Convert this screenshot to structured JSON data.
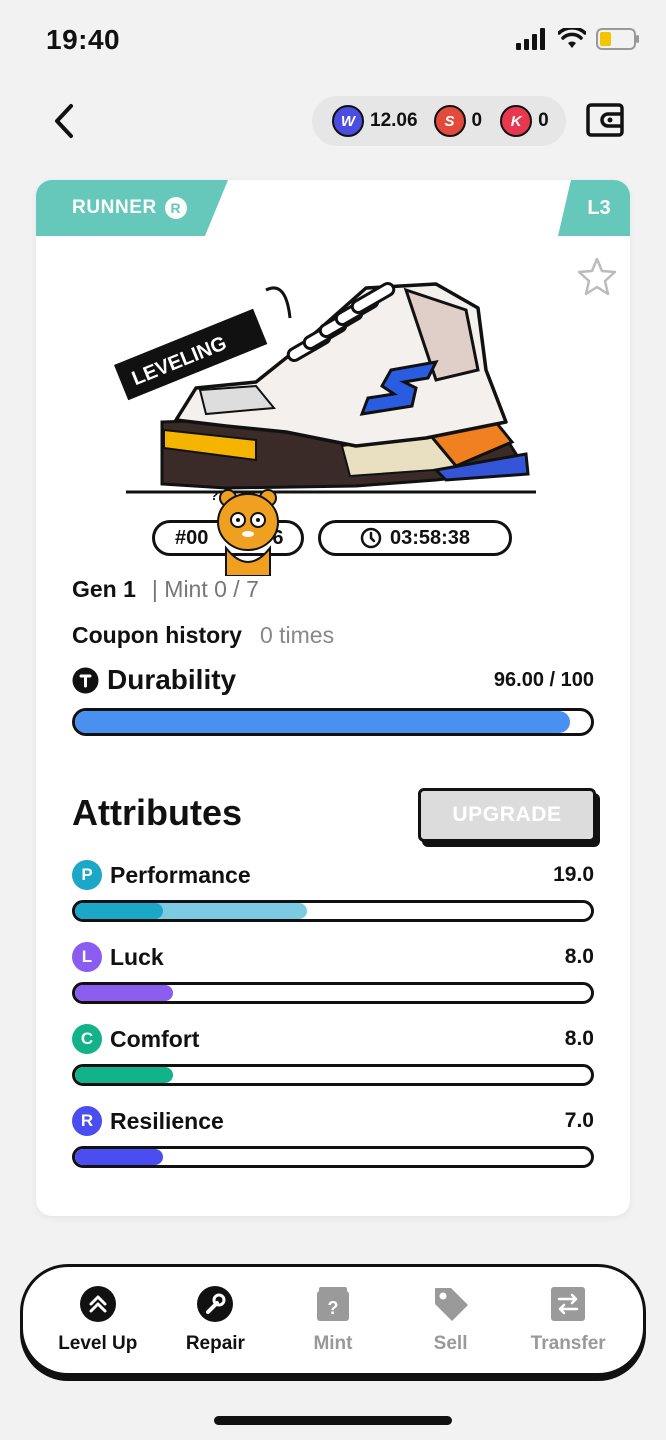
{
  "status_bar": {
    "time": "19:40",
    "battery_level": 0.35
  },
  "header": {
    "tokens": [
      {
        "name": "gmt",
        "value": "12.06",
        "icon": "w-coin-icon",
        "color": "#4a4de0",
        "glyph": "W"
      },
      {
        "name": "sgt",
        "value": "0",
        "icon": "s-coin-icon",
        "color": "#e24a3c",
        "glyph": "S"
      },
      {
        "name": "kgt",
        "value": "0",
        "icon": "k-coin-icon",
        "color": "#e8384f",
        "glyph": "K"
      }
    ]
  },
  "card": {
    "type_label": "RUNNER",
    "type_badge": "R",
    "level": "L3",
    "leveling_tag": "LEVELING",
    "shoe_id": "#00",
    "shoe_id_suffix": "6",
    "timer": "03:58:38",
    "gen": "Gen 1",
    "mint": "| Mint 0 / 7",
    "coupon_label": "Coupon history",
    "coupon_value": "0 times",
    "durability_label": "Durability",
    "durability_value": "96.00 / 100",
    "durability_fraction": 0.96,
    "accent_color": "#66c8bb"
  },
  "attributes": {
    "title": "Attributes",
    "upgrade_label": "UPGRADE",
    "items": [
      {
        "badge": "P",
        "name": "Performance",
        "value": "19.0",
        "color": "#1aa7c8",
        "base_fraction": 0.17,
        "boost_fraction": 0.45,
        "boost_color": "#7ccbe3"
      },
      {
        "badge": "L",
        "name": "Luck",
        "value": "8.0",
        "color": "#8b5cf0",
        "base_fraction": 0.19
      },
      {
        "badge": "C",
        "name": "Comfort",
        "value": "8.0",
        "color": "#12b389",
        "base_fraction": 0.19
      },
      {
        "badge": "R",
        "name": "Resilience",
        "value": "7.0",
        "color": "#4a4df0",
        "base_fraction": 0.17
      }
    ]
  },
  "actions": [
    {
      "label": "Level Up",
      "icon": "level-up-icon",
      "enabled": true
    },
    {
      "label": "Repair",
      "icon": "wrench-icon",
      "enabled": true
    },
    {
      "label": "Mint",
      "icon": "mint-box-icon",
      "enabled": false
    },
    {
      "label": "Sell",
      "icon": "tag-icon",
      "enabled": false
    },
    {
      "label": "Transfer",
      "icon": "transfer-icon",
      "enabled": false
    }
  ]
}
